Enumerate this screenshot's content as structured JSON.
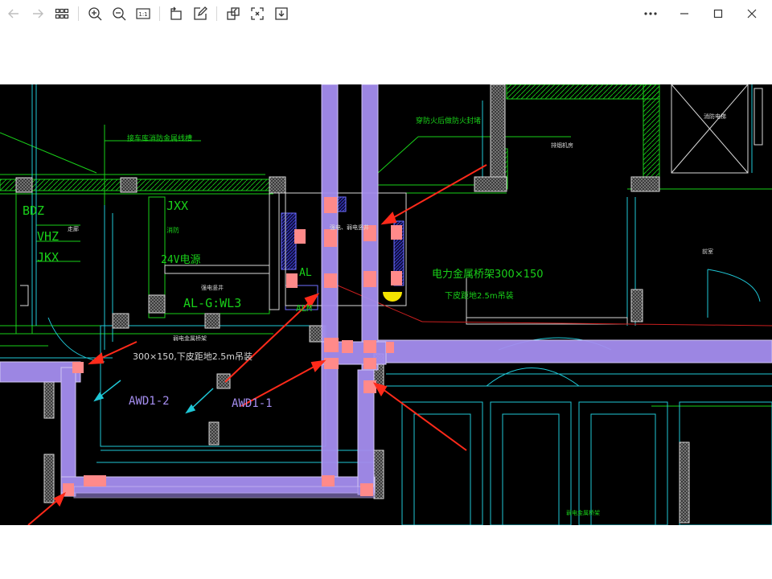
{
  "toolbar": {
    "icons": [
      "arrow-left-icon",
      "arrow-right-icon",
      "grid-icon",
      "zoom-in-icon",
      "zoom-out-icon",
      "actual-size-icon",
      "rotate-icon",
      "edit-icon",
      "crop-icon",
      "fit-screen-icon",
      "download-icon",
      "more-icon"
    ],
    "actual_size_label": "1:1",
    "window": [
      "minimize-icon",
      "maximize-icon",
      "close-icon"
    ]
  },
  "colors": {
    "canvas": "#000000",
    "duct": "#a58ef0",
    "fitting": "#ff8a8a",
    "wall": "#19d019",
    "cyan": "#1fc7d6",
    "white_text": "#d8d8d8",
    "arrow": "#ff2a1a"
  },
  "drawing": {
    "labels": {
      "top_left": "接车库消防金属线槽",
      "top_mid": "穿防火后做防火封堵",
      "top_right_a": "排烟机房",
      "top_right_b": "消防电梯",
      "room_right": "配电间",
      "bdz": "BDZ",
      "vhz": "VHZ",
      "jkx": "JKX",
      "jxx": "JXX",
      "side_note": "走廊",
      "xiaofang": "消防",
      "v24": "24V电源",
      "algwl3_note": "强电竖井",
      "algwl3": "AL-G:WL3",
      "al": "AL",
      "alm": "ALM",
      "room_right2": "前室",
      "tray_upper": "电力金属桥架300×150",
      "tray_upper_sub": "下皮距地2.5m吊装",
      "tray_left_note": "弱电金属桥架",
      "tray_left": "300×150,下皮距地2.5m吊装",
      "awd2": "AWD1-2",
      "awd1": "AWD1-1",
      "shaft_note": "强电、弱电竖井",
      "bottom_right": "弱电金属桥架"
    }
  }
}
